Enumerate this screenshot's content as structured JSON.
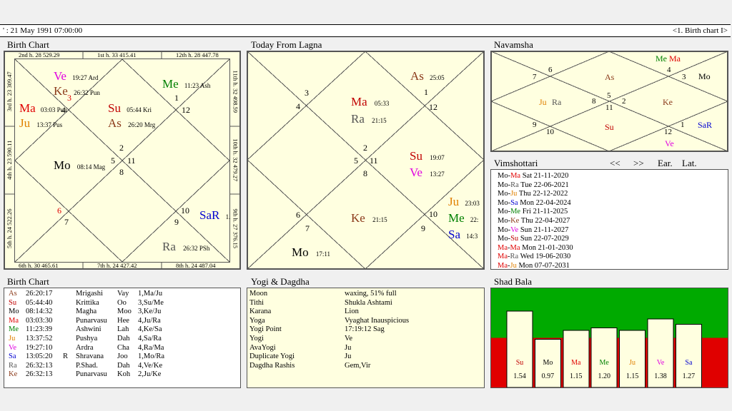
{
  "topbar": {
    "left": "' :   21 May 1991  07:00:00",
    "right": "<1. Birth chart I>"
  },
  "titles": {
    "birth_chart": "Birth Chart",
    "today": "Today From Lagna",
    "navamsha": "Navamsha",
    "vimshottari": "Vimshottari",
    "birth_table": "Birth Chart",
    "yogi": "Yogi & Dagdha",
    "shad_bala": "Shad Bala"
  },
  "vim_controls": {
    "prev": "<<",
    "next": ">>",
    "ear": "Ear.",
    "lat": "Lat."
  },
  "birth_houses": {
    "h1": "1st h.  33  415.41",
    "h2": "2nd h.  28  529.29",
    "h12": "12th h.  28  447.78",
    "h3": "3rd h.  23  309.47",
    "h11": "11th h.  32  498.59",
    "h4": "4th h.  23  590.11",
    "h10": "10th h.  32  479.27",
    "h5": "5th h.  24  522.26",
    "h9": "9th h.  27  376.15",
    "h6": "6th h.  30  465.61",
    "h7": "7th h.  24  427.42",
    "h8": "8th h.  24  487.04"
  },
  "birth_chart": {
    "signs": {
      "s1": "1",
      "s12": "12",
      "s3": "3",
      "s4": "4",
      "s2": "2",
      "s5": "5",
      "s11": "11",
      "s8": "8",
      "s6": "6",
      "s7": "7",
      "s10": "10",
      "s9": "9"
    },
    "planets": [
      {
        "abbr": "Ve",
        "detail": "19:27  Ard",
        "color": "#e000e0"
      },
      {
        "abbr": "Ke",
        "detail": "26:32  Pun",
        "color": "#8b3a1a"
      },
      {
        "abbr": "Me",
        "detail": "11:23  Ash",
        "color": "#008000"
      },
      {
        "abbr": "Ma",
        "detail": "03:03 Pun",
        "color": "#e00000"
      },
      {
        "abbr": "Ju",
        "detail": "13:37  Pus",
        "color": "#e08000"
      },
      {
        "abbr": "Su",
        "detail": "05:44  Kri",
        "color": "#c00000"
      },
      {
        "abbr": "As",
        "detail": "26:20  Mrg",
        "color": "#8b3a1a"
      },
      {
        "abbr": "Mo",
        "detail": "08:14  Mag",
        "color": "#000000"
      },
      {
        "abbr": "SaR",
        "detail": "1.",
        "color": "#0000d0"
      },
      {
        "abbr": "Ra",
        "detail": "26:32  PSh",
        "color": "#555555"
      }
    ]
  },
  "today_chart": {
    "signs": {
      "s1": "1",
      "s12": "12",
      "s3": "3",
      "s4": "4",
      "s2": "2",
      "s5": "5",
      "s11": "11",
      "s8": "8",
      "s6": "6",
      "s7": "7",
      "s10": "10",
      "s9": "9"
    },
    "planets": [
      {
        "abbr": "As",
        "detail": "25:05",
        "color": "#8b3a1a"
      },
      {
        "abbr": "Ma",
        "detail": "05:33",
        "color": "#c00000"
      },
      {
        "abbr": "Ra",
        "detail": "21:15",
        "color": "#555555"
      },
      {
        "abbr": "Su",
        "detail": "19:07",
        "color": "#c00000"
      },
      {
        "abbr": "Ve",
        "detail": "13:27",
        "color": "#e000e0"
      },
      {
        "abbr": "Ke",
        "detail": "21:15",
        "color": "#8b3a1a"
      },
      {
        "abbr": "Ju",
        "detail": "23:03",
        "color": "#e08000"
      },
      {
        "abbr": "Me",
        "detail": "22:",
        "color": "#008000"
      },
      {
        "abbr": "Sa",
        "detail": "14:3",
        "color": "#0000d0"
      },
      {
        "abbr": "Mo",
        "detail": "17:11",
        "color": "#000000"
      }
    ]
  },
  "navamsha": {
    "signs": {
      "s4": "4",
      "s3": "3",
      "s6": "6",
      "s7": "7",
      "s5": "5",
      "s8": "8",
      "s11": "11",
      "s2": "2",
      "s9": "9",
      "s10": "10",
      "s12": "12",
      "s1": "1"
    },
    "planets": {
      "me": "Me",
      "ma": "Ma",
      "mo": "Mo",
      "as": "As",
      "ju": "Ju",
      "ra": "Ra",
      "ke": "Ke",
      "su": "Su",
      "sar": "SaR",
      "ve": "Ve"
    }
  },
  "vimshottari": [
    {
      "p1": "Mo",
      "c1": "#000000",
      "p2": "Ma",
      "c2": "#e00000",
      "date": "Sat   21-11-2020"
    },
    {
      "p1": "Mo",
      "c1": "#000000",
      "p2": "Ra",
      "c2": "#555555",
      "date": "Tue   22-06-2021"
    },
    {
      "p1": "Mo",
      "c1": "#000000",
      "p2": "Ju",
      "c2": "#e08000",
      "date": "Thu   22-12-2022"
    },
    {
      "p1": "Mo",
      "c1": "#000000",
      "p2": "Sa",
      "c2": "#0000d0",
      "date": "Mon  22-04-2024"
    },
    {
      "p1": "Mo",
      "c1": "#000000",
      "p2": "Me",
      "c2": "#008000",
      "date": "Fri    21-11-2025"
    },
    {
      "p1": "Mo",
      "c1": "#000000",
      "p2": "Ke",
      "c2": "#8b3a1a",
      "date": "Thu   22-04-2027"
    },
    {
      "p1": "Mo",
      "c1": "#000000",
      "p2": "Ve",
      "c2": "#e000e0",
      "date": "Sun   21-11-2027"
    },
    {
      "p1": "Mo",
      "c1": "#000000",
      "p2": "Su",
      "c2": "#c00000",
      "date": "Sun   22-07-2029"
    },
    {
      "p1": "Ma",
      "c1": "#e00000",
      "p2": "Ma",
      "c2": "#e00000",
      "date": "Mon  21-01-2030"
    },
    {
      "p1": "Ma",
      "c1": "#e00000",
      "p2": "Ra",
      "c2": "#555555",
      "date": "Wed  19-06-2030"
    },
    {
      "p1": "Ma",
      "c1": "#e00000",
      "p2": "Ju",
      "c2": "#e08000",
      "date": "Mon  07-07-2031"
    }
  ],
  "birth_table": [
    {
      "p": "As",
      "c": "#8b3a1a",
      "deg": "26:20:17",
      "r": "",
      "nak": "Mrigashi",
      "syl": "Vay",
      "pad": "1,Ma/Ju"
    },
    {
      "p": "Su",
      "c": "#c00000",
      "deg": "05:44:40",
      "r": "",
      "nak": "Krittika",
      "syl": "Oo",
      "pad": "3,Su/Me"
    },
    {
      "p": "Mo",
      "c": "#000000",
      "deg": "08:14:32",
      "r": "",
      "nak": "Magha",
      "syl": "Moo",
      "pad": "3,Ke/Ju"
    },
    {
      "p": "Ma",
      "c": "#e00000",
      "deg": "03:03:30",
      "r": "",
      "nak": "Punarvasu",
      "syl": "Hee",
      "pad": "4,Ju/Ra"
    },
    {
      "p": "Me",
      "c": "#008000",
      "deg": "11:23:39",
      "r": "",
      "nak": "Ashwini",
      "syl": "Lah",
      "pad": "4,Ke/Sa"
    },
    {
      "p": "Ju",
      "c": "#e08000",
      "deg": "13:37:52",
      "r": "",
      "nak": "Pushya",
      "syl": "Dah",
      "pad": "4,Sa/Ra"
    },
    {
      "p": "Ve",
      "c": "#e000e0",
      "deg": "19:27:10",
      "r": "",
      "nak": "Ardra",
      "syl": "Cha",
      "pad": "4,Ra/Ma"
    },
    {
      "p": "Sa",
      "c": "#0000d0",
      "deg": "13:05:20",
      "r": "R",
      "nak": "Shravana",
      "syl": "Joo",
      "pad": "1,Mo/Ra"
    },
    {
      "p": "Ra",
      "c": "#555555",
      "deg": "26:32:13",
      "r": "",
      "nak": "P.Shad.",
      "syl": "Dah",
      "pad": "4,Ve/Ke"
    },
    {
      "p": "Ke",
      "c": "#8b3a1a",
      "deg": "26:32:13",
      "r": "",
      "nak": "Punarvasu",
      "syl": "Koh",
      "pad": "2,Ju/Ke"
    }
  ],
  "yogi": [
    {
      "k": "Moon",
      "v": "waxing, 51% full"
    },
    {
      "k": "Tithi",
      "v": "Shukla  Ashtami"
    },
    {
      "k": "Karana",
      "v": "Lion"
    },
    {
      "k": "Yoga",
      "v": "Vyaghat Inauspicious"
    },
    {
      "k": "Yogi Point",
      "v": "17:19:12 Sag"
    },
    {
      "k": "Yogi",
      "v": "Ve"
    },
    {
      "k": "AvaYogi",
      "v": "Ju"
    },
    {
      "k": "Duplicate Yogi",
      "v": "Ju"
    },
    {
      "k": "Dagdha Rashis",
      "v": "Gem,Vir"
    }
  ],
  "shad_bala": {
    "threshold": 1.0,
    "max": 2.0,
    "colors": {
      "above": "#00aa00",
      "below": "#e00000"
    },
    "bars": [
      {
        "name": "Su",
        "value": 1.54,
        "label": "1.54",
        "color": "#c00000"
      },
      {
        "name": "Mo",
        "value": 0.97,
        "label": "0.97",
        "color": "#000000"
      },
      {
        "name": "Ma",
        "value": 1.15,
        "label": "1.15",
        "color": "#e00000"
      },
      {
        "name": "Me",
        "value": 1.2,
        "label": "1.20",
        "color": "#008000"
      },
      {
        "name": "Ju",
        "value": 1.15,
        "label": "1.15",
        "color": "#e08000"
      },
      {
        "name": "Ve",
        "value": 1.38,
        "label": "1.38",
        "color": "#e000e0"
      },
      {
        "name": "Sa",
        "value": 1.27,
        "label": "1.27",
        "color": "#0000d0"
      }
    ]
  }
}
